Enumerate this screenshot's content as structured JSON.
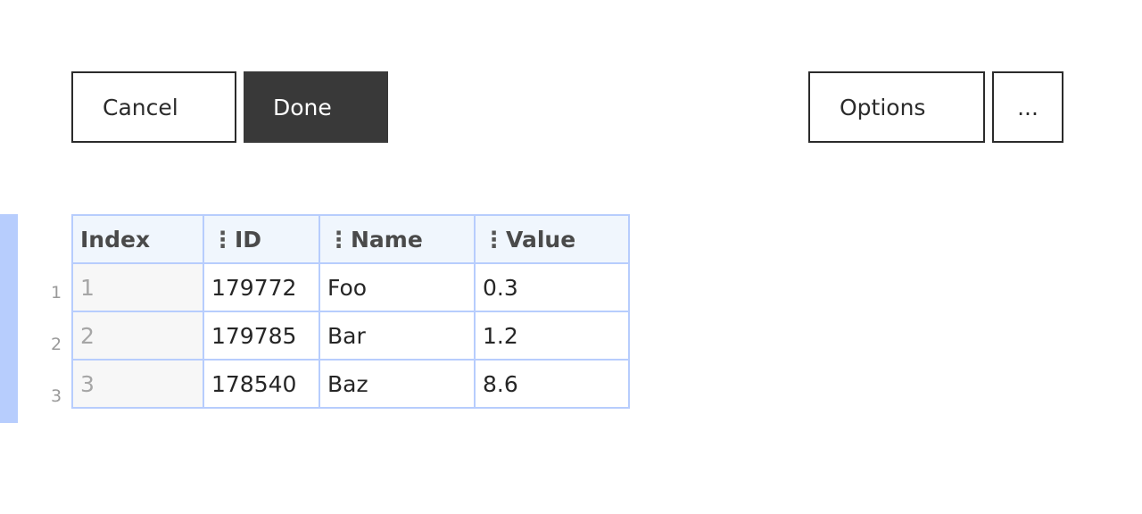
{
  "toolbar": {
    "cancel_label": "Cancel",
    "done_label": "Done",
    "options_label": "Options",
    "more_label": "..."
  },
  "table": {
    "columns": [
      "Index",
      "ID",
      "Name",
      "Value"
    ],
    "drag_icon": "⋮",
    "row_numbers": [
      "1",
      "2",
      "3"
    ],
    "rows": [
      [
        "1",
        "179772",
        "Foo",
        "0.3"
      ],
      [
        "2",
        "179785",
        "Bar",
        "1.2"
      ],
      [
        "3",
        "178540",
        "Baz",
        "8.6"
      ]
    ]
  },
  "colors": {
    "primary_button": "#393939",
    "grid_border": "#b7cdfd",
    "header_background": "#f0f6fd",
    "selection_bar": "#b7cdfd"
  }
}
